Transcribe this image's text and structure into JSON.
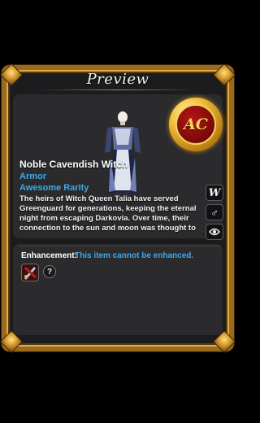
{
  "window": {
    "title": "Preview"
  },
  "coin": {
    "text": "AC",
    "icon": "ac-coin-icon"
  },
  "item": {
    "name": "Noble Cavendish Witch",
    "type": "Armor",
    "rarity": "Awesome Rarity",
    "description": "The heirs of Witch Queen Talia have served Greenguard for generations, keeping the eternal night from escaping Darkovia. Over time, their connection to the sun and moon was thought to be"
  },
  "side_buttons": [
    {
      "icon": "w-icon",
      "label": "W"
    },
    {
      "icon": "gender-male-icon",
      "label": "♂"
    },
    {
      "icon": "eye-icon",
      "label": ""
    }
  ],
  "enhancement": {
    "label": "Enhancement:",
    "text": "This item cannot be enhanced.",
    "icon": "enhancement-weapon-icon",
    "help_label": "?"
  },
  "colors": {
    "accent_blue": "#3ea8e6",
    "frame_gold": "#9a6a1e",
    "panel": "#2b2b2d"
  }
}
